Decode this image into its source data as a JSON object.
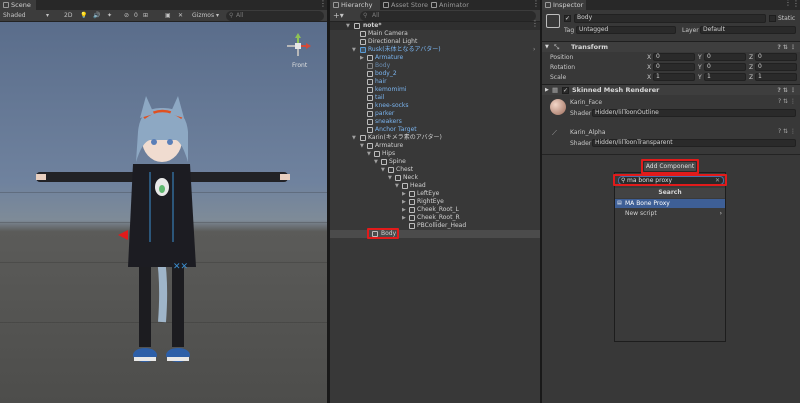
{
  "scene": {
    "tab": "Scene",
    "shading": "Shaded",
    "mode_2d": "2D",
    "gizmos": "Gizmos",
    "search_placeholder": "All",
    "hidden_count": "0",
    "view_label": "Front"
  },
  "hierarchy": {
    "tabs": [
      "Hierarchy",
      "Asset Store",
      "Animator"
    ],
    "add_label": "+▾",
    "search_placeholder": "All",
    "items": [
      {
        "label": "note*"
      },
      {
        "label": "Main Camera"
      },
      {
        "label": "Directional Light"
      },
      {
        "label": "Rusk(未体となるアバター)"
      },
      {
        "label": "Armature"
      },
      {
        "label": "Body"
      },
      {
        "label": "body_2"
      },
      {
        "label": "hair"
      },
      {
        "label": "kemomimi"
      },
      {
        "label": "tail"
      },
      {
        "label": "knee-socks"
      },
      {
        "label": "parker"
      },
      {
        "label": "sneakers"
      },
      {
        "label": "Anchor Target"
      },
      {
        "label": "Karin(キメラ素のアバター)"
      },
      {
        "label": "Armature"
      },
      {
        "label": "Hips"
      },
      {
        "label": "Spine"
      },
      {
        "label": "Chest"
      },
      {
        "label": "Neck"
      },
      {
        "label": "Head"
      },
      {
        "label": "LeftEye"
      },
      {
        "label": "RightEye"
      },
      {
        "label": "Cheek_Root_L"
      },
      {
        "label": "Cheek_Root_R"
      },
      {
        "label": "PBCollider_Head"
      },
      {
        "label": "Body"
      }
    ]
  },
  "inspector": {
    "tab": "Inspector",
    "object_name": "Body",
    "static_label": "Static",
    "tag_label": "Tag",
    "tag_value": "Untagged",
    "layer_label": "Layer",
    "layer_value": "Default",
    "transform": {
      "title": "Transform",
      "rows": [
        {
          "label": "Position",
          "x": "0",
          "y": "0",
          "z": "0"
        },
        {
          "label": "Rotation",
          "x": "0",
          "y": "0",
          "z": "0"
        },
        {
          "label": "Scale",
          "x": "1",
          "y": "1",
          "z": "1"
        }
      ],
      "axis_x": "X",
      "axis_y": "Y",
      "axis_z": "Z"
    },
    "skinned_mesh": {
      "title": "Skinned Mesh Renderer"
    },
    "materials": [
      {
        "name": "Karin_Face",
        "shader_label": "Shader",
        "shader_value": "Hidden/lilToonOutline"
      },
      {
        "name": "Karin_Alpha",
        "shader_label": "Shader",
        "shader_value": "Hidden/lilToonTransparent"
      }
    ],
    "add_component": {
      "button": "Add Component",
      "search_value": "ma bone proxy",
      "result_header": "Search",
      "results": [
        {
          "label": "MA Bone Proxy"
        },
        {
          "label": "New script"
        }
      ]
    }
  },
  "colors": {
    "accent_selected": "#3e5f96",
    "highlight_red": "#e11b1b",
    "prefab_blue": "#7ab4ef"
  }
}
